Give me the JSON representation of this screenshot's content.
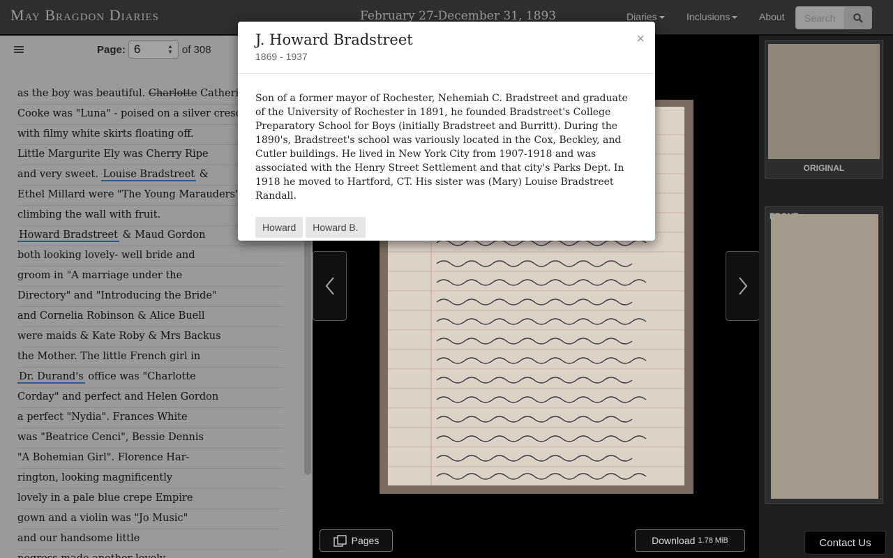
{
  "nav": {
    "brand": "May Bragdon Diaries",
    "title": "February 27-December 31, 1893",
    "items": [
      {
        "label": "Diaries",
        "dropdown": true
      },
      {
        "label": "Inclusions",
        "dropdown": true
      },
      {
        "label": "About",
        "dropdown": false
      }
    ],
    "search_placeholder": "Search"
  },
  "pager": {
    "label": "Page:",
    "current": "6",
    "of": "of 308"
  },
  "transcript": {
    "lines": [
      {
        "segments": [
          {
            "t": "as the boy was beautiful. "
          },
          {
            "t": "Charlotte",
            "strike": true
          },
          {
            "t": " Catherine"
          }
        ]
      },
      {
        "segments": [
          {
            "t": "Cooke was \"Luna\" - poised on a silver crescent"
          }
        ]
      },
      {
        "segments": [
          {
            "t": "with filmy white skirts floating off."
          }
        ]
      },
      {
        "segments": [
          {
            "t": "Little Margurite Ely was Cherry Ripe"
          }
        ]
      },
      {
        "segments": [
          {
            "t": "and very sweet. "
          },
          {
            "t": "Louise Bradstreet",
            "link": true
          },
          {
            "t": " &"
          }
        ]
      },
      {
        "segments": [
          {
            "t": "Ethel Millard were \"The Young Marauders\""
          }
        ]
      },
      {
        "segments": [
          {
            "t": "climbing the wall with fruit."
          }
        ]
      },
      {
        "segments": [
          {
            "t": "Howard Bradstreet",
            "link": true
          },
          {
            "t": " & Maud Gordon"
          }
        ]
      },
      {
        "segments": [
          {
            "t": "both looking lovely- well bride and"
          }
        ]
      },
      {
        "segments": [
          {
            "t": "groom in \"A marriage under the"
          }
        ]
      },
      {
        "segments": [
          {
            "t": "Directory\" and \"Introducing the Bride\""
          }
        ]
      },
      {
        "segments": [
          {
            "t": "and Cornelia Robinson & Alice Buell"
          }
        ]
      },
      {
        "segments": [
          {
            "t": "were maids & Kate Roby & Mrs Backus"
          }
        ]
      },
      {
        "segments": [
          {
            "t": "the Mother. The little French girl in"
          }
        ]
      },
      {
        "segments": [
          {
            "t": "Dr. Durand's",
            "link": true
          },
          {
            "t": " office was \"Charlotte"
          }
        ]
      },
      {
        "segments": [
          {
            "t": "Corday\" and perfect and Helen Gordon"
          }
        ]
      },
      {
        "segments": [
          {
            "t": "a perfect \"Nydia\". Frances White"
          }
        ]
      },
      {
        "segments": [
          {
            "t": "was \"Beatrice Cenci\", Bessie Dennis"
          }
        ]
      },
      {
        "segments": [
          {
            "t": "\"A Bohemian Girl\". Florence Har-"
          }
        ]
      },
      {
        "segments": [
          {
            "t": "rington, looking magnificently"
          }
        ]
      },
      {
        "segments": [
          {
            "t": "lovely in a pale blue crepe Empire"
          }
        ]
      },
      {
        "segments": [
          {
            "t": "gown and a violin was \"Jo Music\""
          }
        ]
      },
      {
        "segments": [
          {
            "t": "and our handsome little"
          }
        ]
      },
      {
        "segments": [
          {
            "t": "negress made another lovely"
          }
        ]
      }
    ]
  },
  "buttons": {
    "pages": "Pages",
    "download": "Download",
    "download_size": "1.78 MiB",
    "contact": "Contact Us"
  },
  "thumbs": [
    {
      "label": "ORIGINAL"
    },
    {
      "label": "FRONT"
    }
  ],
  "modal": {
    "title": "J. Howard Bradstreet",
    "dates": "1869 - 1937",
    "bio": "Son of a former mayor of Rochester, Nehemiah C. Bradstreet and graduate of the University of Rochester in 1891, he founded Bradstreet's College Preparatory School for Boys (initially Bradstreet and Burritt). During the 1890's, Bradstreet's school was variously located in the Cox, Beckley, and Cutler buildings. He lived in New York City from 1907-1918 and was associated with the Henry Street Settlement and that city's Parks Dept. In 1918 he moved to Hartford, CT. His sister was (Mary) Louise Bradstreet Randall.",
    "tags": [
      "Howard",
      "Howard B."
    ],
    "close": "×"
  }
}
